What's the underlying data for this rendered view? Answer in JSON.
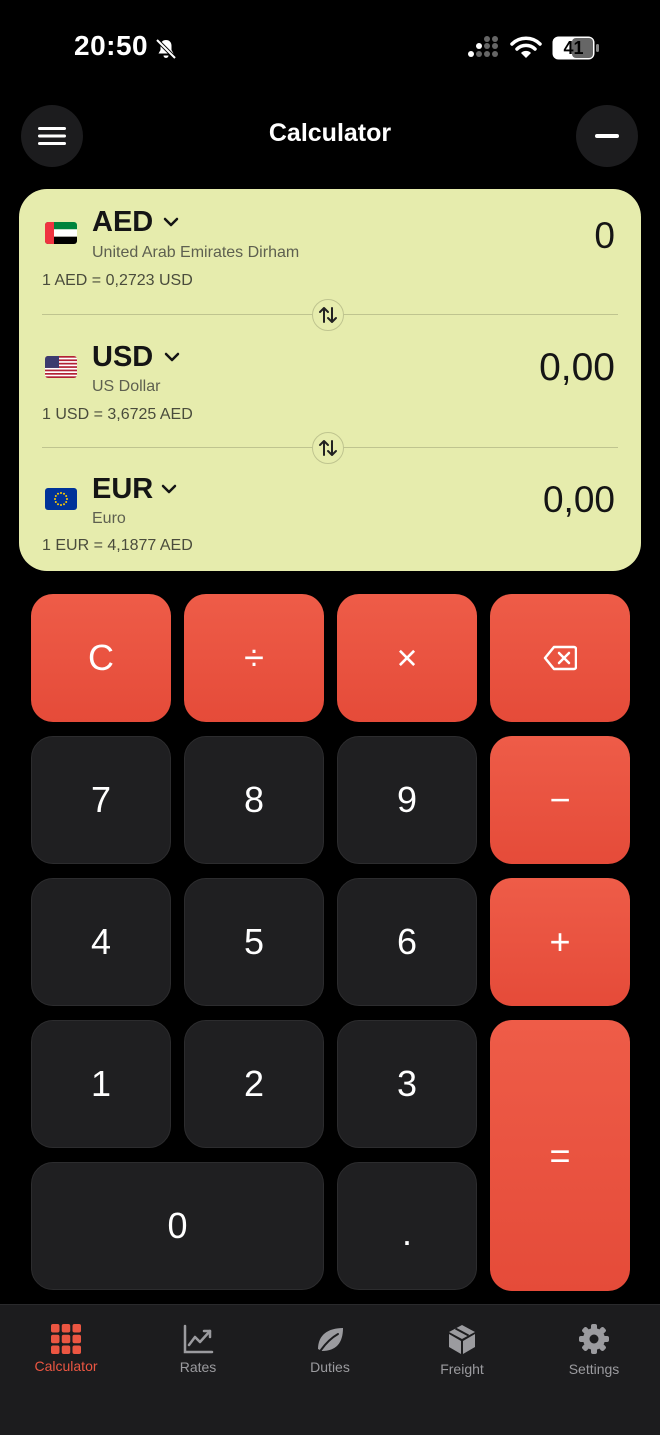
{
  "status_bar": {
    "time": "20:50",
    "battery": "41"
  },
  "header": {
    "title": "Calculator"
  },
  "currencies": [
    {
      "code": "AED",
      "name": "United Arab Emirates Dirham",
      "rate": "1 AED = 0,2723 USD",
      "amount": "0"
    },
    {
      "code": "USD",
      "name": "US Dollar",
      "rate": "1 USD = 3,6725 AED",
      "amount": "0,00"
    },
    {
      "code": "EUR",
      "name": "Euro",
      "rate": "1 EUR = 4,1877 AED",
      "amount": "0,00"
    }
  ],
  "keypad": {
    "clear": "C",
    "divide": "÷",
    "multiply": "×",
    "minus": "−",
    "plus": "+",
    "equals": "=",
    "decimal": ".",
    "digits": {
      "0": "0",
      "1": "1",
      "2": "2",
      "3": "3",
      "4": "4",
      "5": "5",
      "6": "6",
      "7": "7",
      "8": "8",
      "9": "9"
    }
  },
  "tabs": [
    {
      "label": "Calculator",
      "icon": "grid-icon",
      "active": true
    },
    {
      "label": "Rates",
      "icon": "chart-icon",
      "active": false
    },
    {
      "label": "Duties",
      "icon": "leaf-icon",
      "active": false
    },
    {
      "label": "Freight",
      "icon": "package-icon",
      "active": false
    },
    {
      "label": "Settings",
      "icon": "gear-icon",
      "active": false
    }
  ],
  "colors": {
    "accent": "#EC5642",
    "card": "#E6ECAD",
    "key_dark": "#1F1F21",
    "background": "#000000"
  }
}
